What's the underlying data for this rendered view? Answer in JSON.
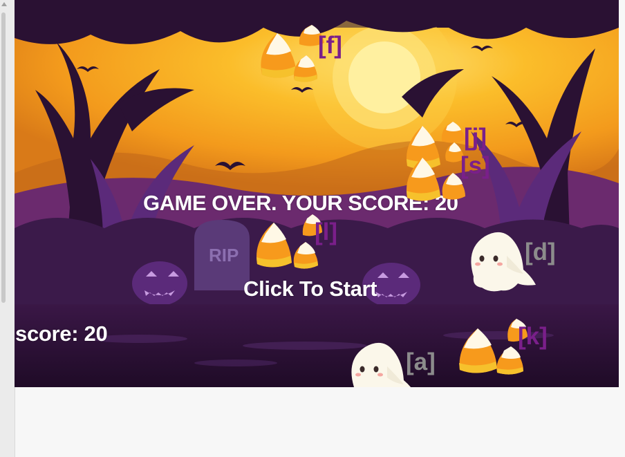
{
  "game": {
    "game_over_text": "GAME OVER. YOUR SCORE: 20",
    "start_prompt": "Click To Start",
    "score_hud": "score: 20"
  },
  "sprites": {
    "candy_f": {
      "kind": "candy-corn",
      "key": "[f]"
    },
    "candy_j": {
      "kind": "candy-corn",
      "key": "[j]"
    },
    "candy_s": {
      "kind": "candy-corn",
      "key": "[s]"
    },
    "candy_l": {
      "kind": "candy-corn",
      "key": "[l]"
    },
    "candy_k": {
      "kind": "candy-corn",
      "key": "[k]"
    },
    "ghost_d": {
      "kind": "ghost",
      "key": "[d]"
    },
    "ghost_a": {
      "kind": "ghost",
      "key": "[a]"
    }
  },
  "colors": {
    "sky_orange": "#f7a41c",
    "moon": "#fde37a",
    "forest_purple": "#4a1f5c",
    "ground": "#2a1133",
    "candy_key_label": "#7a1f8a",
    "ghost_key_label": "#8c8c8c"
  }
}
